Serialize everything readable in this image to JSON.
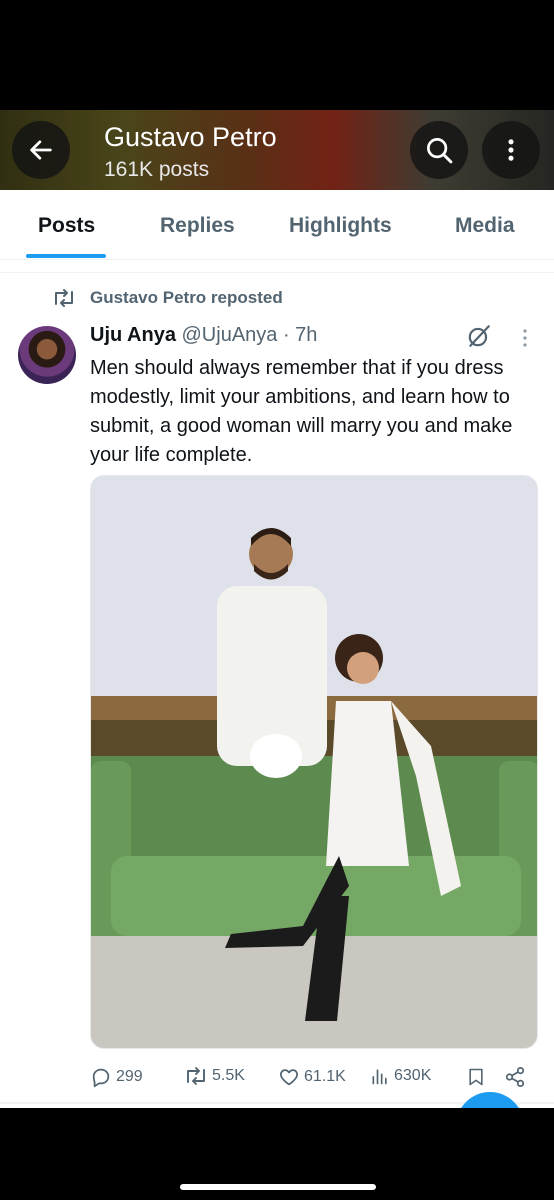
{
  "header": {
    "title": "Gustavo Petro",
    "subtitle": "161K posts",
    "back_icon": "arrow-left-icon",
    "search_icon": "search-icon",
    "more_icon": "more-vertical-icon"
  },
  "tabs": [
    {
      "label": "Posts",
      "active": true
    },
    {
      "label": "Replies",
      "active": false
    },
    {
      "label": "Highlights",
      "active": false
    },
    {
      "label": "Media",
      "active": false
    }
  ],
  "post": {
    "repost_label": "Gustavo Petro reposted",
    "author_name": "Uju Anya",
    "author_meta": "@UjuAnya · 7h",
    "text": "Men should always remember that if you dress modestly, limit your ambitions, and learn how to submit, a good woman will marry you and make your life complete.",
    "stats": {
      "replies": "299",
      "reposts": "5.5K",
      "likes": "61.1K",
      "views": "630K"
    }
  },
  "colors": {
    "accent": "#1d9bf0",
    "text_primary": "#0f1419",
    "text_secondary": "#536471"
  }
}
